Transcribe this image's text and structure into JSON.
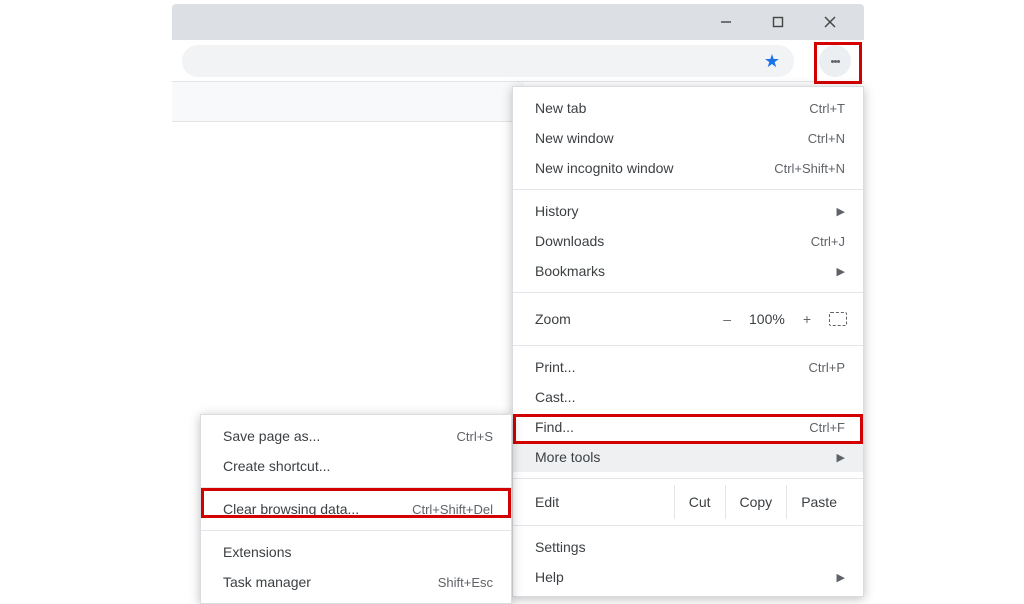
{
  "window_controls": {
    "minimize": "–",
    "maximize": "❐",
    "close": "✕"
  },
  "menu": {
    "new_tab": {
      "label": "New tab",
      "shortcut": "Ctrl+T"
    },
    "new_window": {
      "label": "New window",
      "shortcut": "Ctrl+N"
    },
    "incognito": {
      "label": "New incognito window",
      "shortcut": "Ctrl+Shift+N"
    },
    "history": {
      "label": "History"
    },
    "downloads": {
      "label": "Downloads",
      "shortcut": "Ctrl+J"
    },
    "bookmarks": {
      "label": "Bookmarks"
    },
    "zoom": {
      "label": "Zoom",
      "minus": "–",
      "pct": "100%",
      "plus": "+"
    },
    "print": {
      "label": "Print...",
      "shortcut": "Ctrl+P"
    },
    "cast": {
      "label": "Cast..."
    },
    "find": {
      "label": "Find...",
      "shortcut": "Ctrl+F"
    },
    "more_tools": {
      "label": "More tools"
    },
    "edit": {
      "label": "Edit",
      "cut": "Cut",
      "copy": "Copy",
      "paste": "Paste"
    },
    "settings": {
      "label": "Settings"
    },
    "help": {
      "label": "Help"
    }
  },
  "submenu": {
    "save_page": {
      "label": "Save page as...",
      "shortcut": "Ctrl+S"
    },
    "shortcut": {
      "label": "Create shortcut..."
    },
    "clear": {
      "label": "Clear browsing data...",
      "shortcut": "Ctrl+Shift+Del"
    },
    "extensions": {
      "label": "Extensions"
    },
    "taskmgr": {
      "label": "Task manager",
      "shortcut": "Shift+Esc"
    }
  }
}
